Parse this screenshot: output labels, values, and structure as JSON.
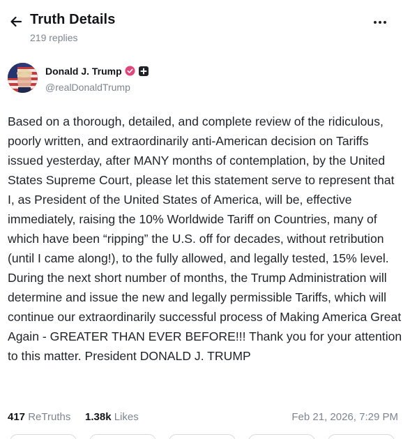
{
  "header": {
    "title": "Truth Details",
    "subtitle": "219 replies"
  },
  "author": {
    "name": "Donald J. Trump",
    "handle": "@realDonaldTrump"
  },
  "post": {
    "body": "Based on a thorough, detailed, and complete review of the ridiculous, poorly written, and extraordinarily anti-American decision on Tariffs issued yesterday, after MANY months of contemplation, by the United States Supreme Court, please let this statement serve to represent that I, as President of the United States of America, will be, effective immediately, raising the 10% Worldwide Tariff on Countries, many of which have been “ripping” the U.S. off for decades, without retribution (until I came along!), to the fully allowed, and legally tested, 15% level. During the next short number of months, the Trump Administration will determine and issue the new and legally permissible Tariffs, which will continue our extraordinarily successful process of Making America Great Again - GREATER THAN EVER BEFORE!!! Thank you for your attention to this matter. President DONALD J. TRUMP"
  },
  "stats": {
    "retruths_count": "417",
    "retruths_label": "ReTruths",
    "likes_count": "1.38k",
    "likes_label": "Likes",
    "timestamp": "Feb 21, 2026, 7:29 PM"
  },
  "icons": {
    "back": "arrow-left-icon",
    "more": "more-horizontal-icon",
    "verified": "verified-badge-icon",
    "plus": "plus-badge-icon"
  },
  "colors": {
    "verified_badge": "#e0467c",
    "muted_text": "#7d8591",
    "primary_text": "#121417"
  }
}
